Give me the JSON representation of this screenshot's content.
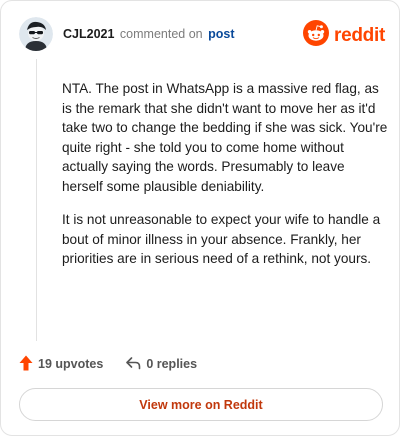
{
  "header": {
    "username": "CJL2021",
    "action_text": "commented on",
    "post_link_text": "post",
    "brand_name": "reddit"
  },
  "comment": {
    "paragraphs": [
      "NTA. The post in WhatsApp is a massive red flag, as is the remark that she didn't want to move her as it'd take two to change the bedding if she was sick. You're quite right - she told you to come home without actually saying the words. Presumably to leave herself some plausible deniability.",
      "It is not unreasonable to expect your wife to handle a bout of minor illness in your absence. Frankly, her priorities are in serious need of a rethink, not yours."
    ]
  },
  "footer": {
    "upvotes": "19 upvotes",
    "replies": "0 replies"
  },
  "cta": {
    "label": "View more on Reddit"
  },
  "colors": {
    "brand": "#ff4500",
    "upvote": "#ff4500",
    "link": "#0a4a9a",
    "cta_text": "#c1380c"
  },
  "icons": [
    "user-avatar-icon",
    "reddit-logo-icon",
    "upvote-arrow-icon",
    "reply-arrow-icon"
  ]
}
